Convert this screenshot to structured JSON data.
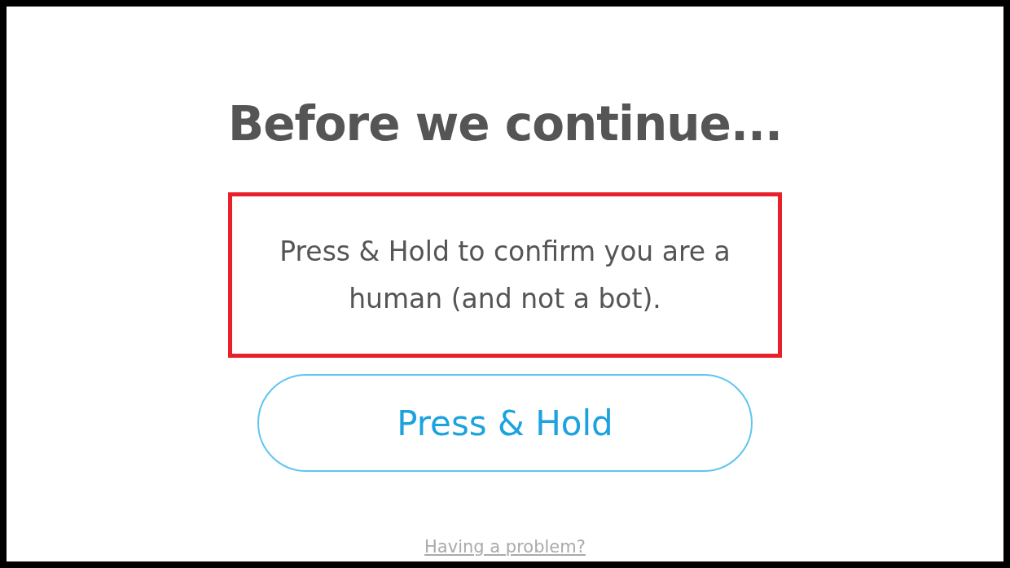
{
  "title": "Before we continue...",
  "message": {
    "text": "Press & Hold to confirm you are a human (and not a bot).",
    "highlighted": true
  },
  "button": {
    "label": "Press & Hold"
  },
  "help_link": {
    "label": "Having a problem?"
  }
}
